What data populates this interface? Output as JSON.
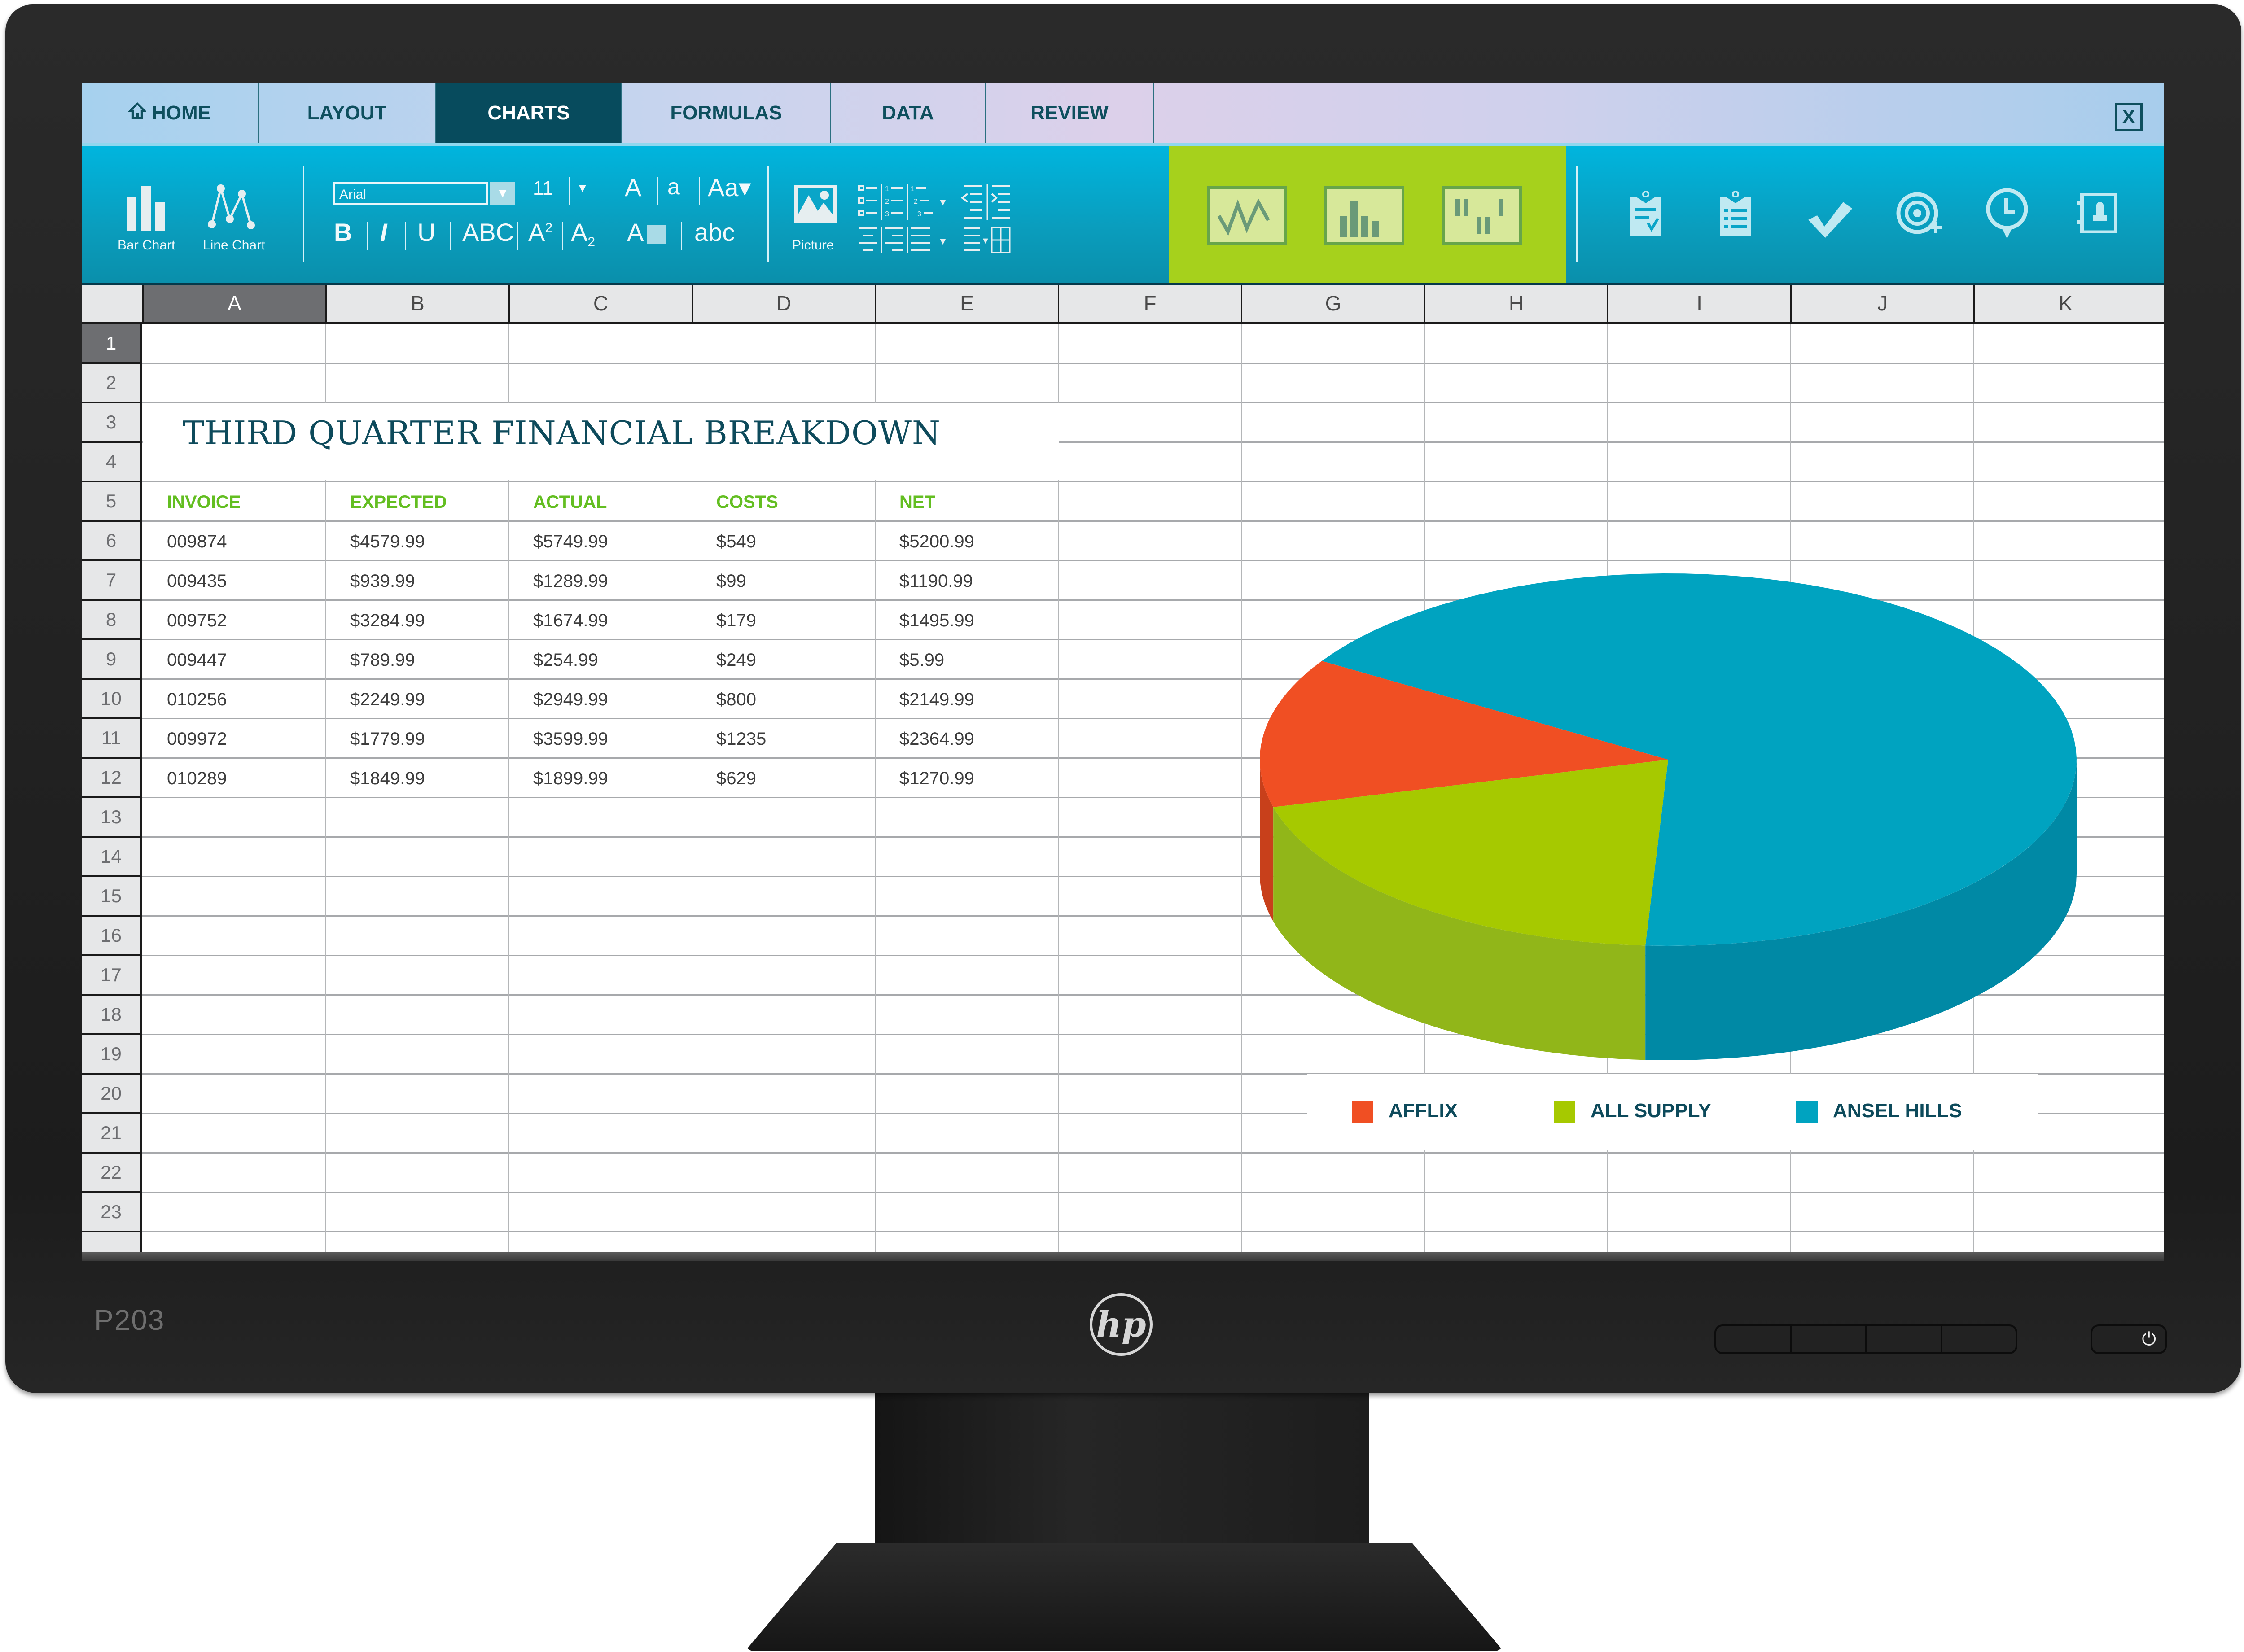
{
  "monitor": {
    "model": "P203",
    "brand_logo": "hp",
    "power_icon": "power-icon"
  },
  "tabs": [
    {
      "label": "HOME",
      "icon": "home-icon",
      "active": false
    },
    {
      "label": "LAYOUT",
      "active": false
    },
    {
      "label": "CHARTS",
      "active": true
    },
    {
      "label": "FORMULAS",
      "active": false
    },
    {
      "label": "DATA",
      "active": false
    },
    {
      "label": "REVIEW",
      "active": false
    }
  ],
  "window": {
    "close_label": "X"
  },
  "ribbon": {
    "bar_chart_label": "Bar Chart",
    "line_chart_label": "Line Chart",
    "font_name": "Arial",
    "font_size": "11",
    "font_dropdown_arrow": "▼",
    "grow_font": "A",
    "shrink_font": "a",
    "change_case": "Aa▾",
    "bold": "B",
    "italic": "I",
    "underline": "U",
    "caps": "ABC",
    "superscript_base": "A",
    "superscript": "2",
    "subscript_base": "A",
    "subscript": "2",
    "highlight": "A",
    "lowercase": "abc",
    "picture_label": "Picture",
    "chart_types": [
      "line-chart-style",
      "column-chart-style",
      "step-chart-style"
    ],
    "right_icons": [
      "clipboard-check-icon",
      "clipboard-list-icon",
      "checkmark-icon",
      "target-add-icon",
      "clock-pin-icon",
      "contact-book-icon"
    ]
  },
  "sheet": {
    "columns": [
      "A",
      "B",
      "C",
      "D",
      "E",
      "F",
      "G",
      "H",
      "I",
      "J",
      "K"
    ],
    "rows": [
      "1",
      "2",
      "3",
      "4",
      "5",
      "6",
      "7",
      "8",
      "9",
      "10",
      "11",
      "12",
      "13",
      "14",
      "15",
      "16",
      "17",
      "18",
      "19",
      "20",
      "21",
      "22",
      "23"
    ],
    "selected_cell": "A1",
    "title": "THIRD QUARTER FINANCIAL BREAKDOWN",
    "table": {
      "headers": [
        "INVOICE",
        "EXPECTED",
        "ACTUAL",
        "COSTS",
        "NET"
      ],
      "rows": [
        [
          "009874",
          "$4579.99",
          "$5749.99",
          "$549",
          "$5200.99"
        ],
        [
          "009435",
          "$939.99",
          "$1289.99",
          "$99",
          "$1190.99"
        ],
        [
          "009752",
          "$3284.99",
          "$1674.99",
          "$179",
          "$1495.99"
        ],
        [
          "009447",
          "$789.99",
          "$254.99",
          "$249",
          "$5.99"
        ],
        [
          "010256",
          "$2249.99",
          "$2949.99",
          "$800",
          "$2149.99"
        ],
        [
          "009972",
          "$1779.99",
          "$3599.99",
          "$1235",
          "$2364.99"
        ],
        [
          "010289",
          "$1849.99",
          "$1899.99",
          "$629",
          "$1270.99"
        ]
      ]
    },
    "header_color": "#63be21"
  },
  "chart_data": {
    "type": "pie",
    "style": "3d",
    "title": "",
    "categories": [
      "AFFLIX",
      "ALL SUPPLY",
      "ANSEL HILLS"
    ],
    "values": [
      13,
      20,
      67
    ],
    "unit": "percent (estimated)",
    "colors": [
      "#f04f23",
      "#a6c900",
      "#00a3c0"
    ],
    "side_colors": [
      "#c8401b",
      "#91b619",
      "#0089a5"
    ],
    "legend": {
      "position": "bottom",
      "entries": [
        "AFFLIX",
        "ALL SUPPLY",
        "ANSEL HILLS"
      ]
    }
  }
}
